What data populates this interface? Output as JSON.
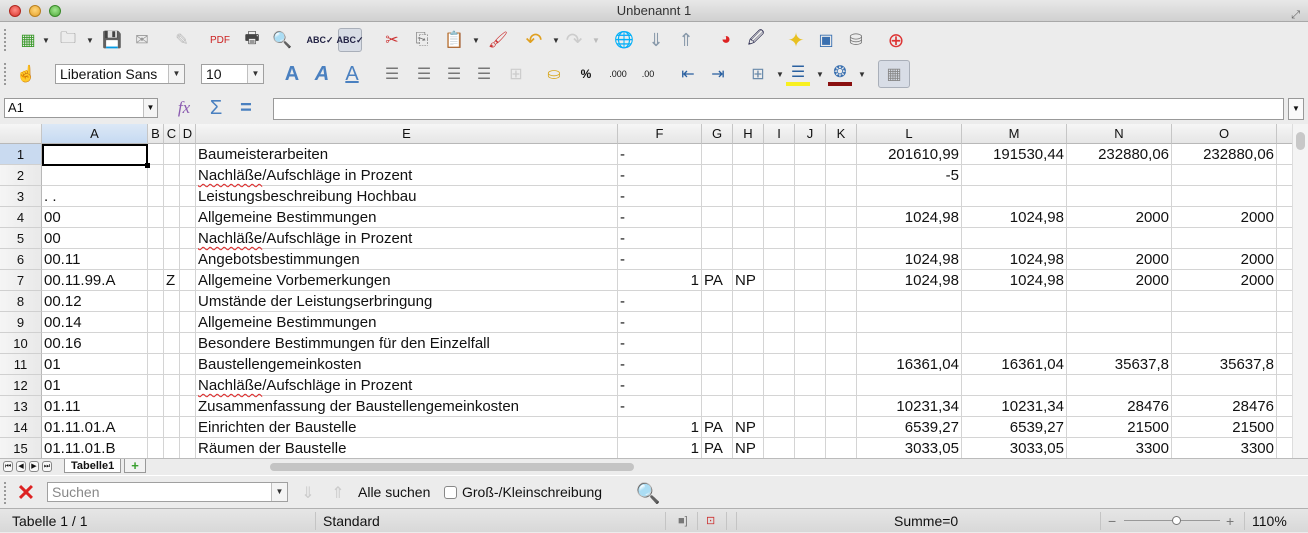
{
  "window": {
    "title": "Unbenannt 1"
  },
  "toolbar1": {
    "icons": [
      "new-spreadsheet-icon",
      "open-folder-icon",
      "save-icon",
      "email-icon",
      "edit-file-icon",
      "export-pdf-icon",
      "print-icon",
      "print-preview-icon",
      "spellcheck-icon",
      "autospellcheck-icon",
      "cut-icon",
      "copy-icon",
      "paste-icon",
      "clone-formatting-icon",
      "undo-icon",
      "redo-icon",
      "hyperlink-icon",
      "sort-ascending-icon",
      "sort-descending-icon",
      "insert-chart-icon",
      "draw-functions-icon",
      "navigator-icon",
      "gallery-icon",
      "data-sources-icon",
      "help-icon"
    ]
  },
  "toolbar2": {
    "font_name": "Liberation Sans",
    "font_size": "10",
    "icons": [
      "styles-icon",
      "bold-icon",
      "italic-icon",
      "underline-icon",
      "align-left-icon",
      "align-center-icon",
      "align-right-icon",
      "justify-icon",
      "merge-cells-icon",
      "currency-icon",
      "percent-icon",
      "add-decimal-icon",
      "delete-decimal-icon",
      "decrease-indent-icon",
      "increase-indent-icon",
      "borders-icon",
      "background-color-icon",
      "font-color-icon",
      "show-grid-icon"
    ]
  },
  "formula_bar": {
    "name_box": "A1",
    "formula": ""
  },
  "columns": [
    "A",
    "B",
    "C",
    "D",
    "E",
    "F",
    "G",
    "H",
    "I",
    "J",
    "K",
    "L",
    "M",
    "N",
    "O"
  ],
  "rows": [
    {
      "n": "1",
      "A": "",
      "C": "",
      "E": "Baumeisterarbeiten",
      "F": "-",
      "G": "",
      "H": "",
      "L": "201610,99",
      "M": "191530,44",
      "N": "232880,06",
      "O": "232880,06"
    },
    {
      "n": "2",
      "A": "",
      "C": "",
      "E": "Nachläße/Aufschläge in Prozent",
      "F": "-",
      "G": "",
      "H": "",
      "L": "-5",
      "M": "",
      "N": "",
      "O": ""
    },
    {
      "n": "3",
      "A": " .  .",
      "C": "",
      "E": "Leistungsbeschreibung Hochbau",
      "F": "-",
      "G": "",
      "H": "",
      "L": "",
      "M": "",
      "N": "",
      "O": ""
    },
    {
      "n": "4",
      "A": "00",
      "C": "",
      "E": "Allgemeine Bestimmungen",
      "F": "-",
      "G": "",
      "H": "",
      "L": "1024,98",
      "M": "1024,98",
      "N": "2000",
      "O": "2000"
    },
    {
      "n": "5",
      "A": "00",
      "C": "",
      "E": "Nachläße/Aufschläge in Prozent",
      "F": "-",
      "G": "",
      "H": "",
      "L": "",
      "M": "",
      "N": "",
      "O": ""
    },
    {
      "n": "6",
      "A": "00.11",
      "C": "",
      "E": "Angebotsbestimmungen",
      "F": "-",
      "G": "",
      "H": "",
      "L": "1024,98",
      "M": "1024,98",
      "N": "2000",
      "O": "2000"
    },
    {
      "n": "7",
      "A": "00.11.99.A",
      "C": "Z",
      "E": "Allgemeine Vorbemerkungen",
      "F": "1",
      "G": "PA",
      "H": "NP",
      "L": "1024,98",
      "M": "1024,98",
      "N": "2000",
      "O": "2000"
    },
    {
      "n": "8",
      "A": "00.12",
      "C": "",
      "E": "Umstände der Leistungserbringung",
      "F": "-",
      "G": "",
      "H": "",
      "L": "",
      "M": "",
      "N": "",
      "O": ""
    },
    {
      "n": "9",
      "A": "00.14",
      "C": "",
      "E": "Allgemeine Bestimmungen",
      "F": "-",
      "G": "",
      "H": "",
      "L": "",
      "M": "",
      "N": "",
      "O": ""
    },
    {
      "n": "10",
      "A": "00.16",
      "C": "",
      "E": "Besondere Bestimmungen für den Einzelfall",
      "F": "-",
      "G": "",
      "H": "",
      "L": "",
      "M": "",
      "N": "",
      "O": ""
    },
    {
      "n": "11",
      "A": "01",
      "C": "",
      "E": "Baustellengemeinkosten",
      "F": "-",
      "G": "",
      "H": "",
      "L": "16361,04",
      "M": "16361,04",
      "N": "35637,8",
      "O": "35637,8"
    },
    {
      "n": "12",
      "A": "01",
      "C": "",
      "E": "Nachläße/Aufschläge in Prozent",
      "F": "-",
      "G": "",
      "H": "",
      "L": "",
      "M": "",
      "N": "",
      "O": ""
    },
    {
      "n": "13",
      "A": "01.11",
      "C": "",
      "E": "Zusammenfassung der Baustellengemeinkosten",
      "F": "-",
      "G": "",
      "H": "",
      "L": "10231,34",
      "M": "10231,34",
      "N": "28476",
      "O": "28476"
    },
    {
      "n": "14",
      "A": "01.11.01.A",
      "C": "",
      "E": "Einrichten der Baustelle",
      "F": "1",
      "G": "PA",
      "H": "NP",
      "L": "6539,27",
      "M": "6539,27",
      "N": "21500",
      "O": "21500"
    },
    {
      "n": "15",
      "A": "01.11.01.B",
      "C": "",
      "E": "Räumen der Baustelle",
      "F": "1",
      "G": "PA",
      "H": "NP",
      "L": "3033,05",
      "M": "3033,05",
      "N": "3300",
      "O": "3300"
    }
  ],
  "sheet_tabs": {
    "active": "Tabelle1"
  },
  "findbar": {
    "placeholder": "Suchen",
    "find_all": "Alle suchen",
    "match_case": "Groß-/Kleinschreibung",
    "match_case_checked": false
  },
  "statusbar": {
    "sheet": "Tabelle 1 / 1",
    "style": "Standard",
    "sum": "Summe=0",
    "zoom_minus": "−",
    "zoom_plus": "+",
    "zoom": "110%",
    "zoom_fraction": 0.55
  }
}
